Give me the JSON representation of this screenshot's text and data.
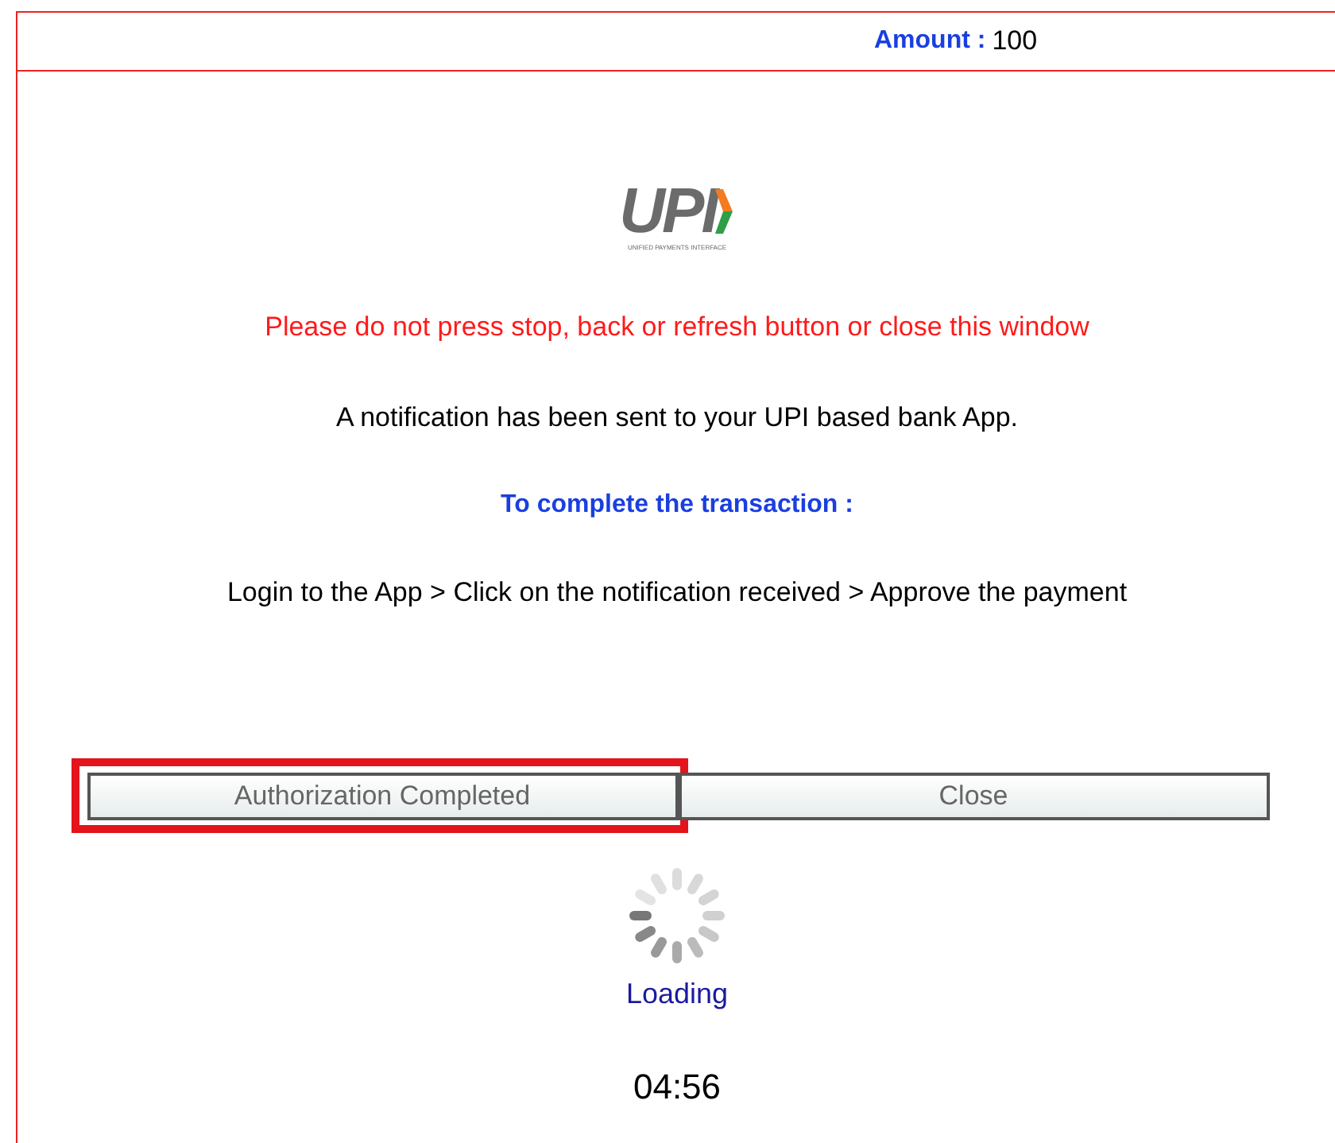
{
  "header": {
    "amount_label": "Amount :",
    "amount_value": "100"
  },
  "logo": {
    "mark": "UPI",
    "tagline": "UNIFIED PAYMENTS INTERFACE"
  },
  "warning": "Please do not press stop, back or refresh button or close this window",
  "notice": "A notification has been sent to your UPI based bank App.",
  "instructions_heading": "To complete the transaction :",
  "instructions": "Login to the App > Click on the notification received > Approve the payment",
  "buttons": [
    {
      "label": "Authorization Completed",
      "highlighted": true
    },
    {
      "label": "Close",
      "highlighted": false
    }
  ],
  "loading": {
    "label": "Loading"
  },
  "timer": "04:56"
}
